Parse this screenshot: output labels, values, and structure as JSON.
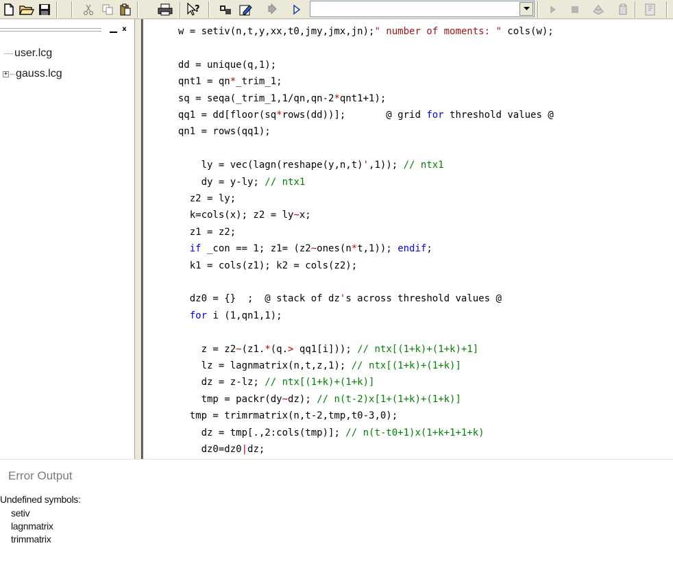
{
  "toolbar": {
    "buttons": [
      "new-file-icon",
      "open-folder-icon",
      "save-icon",
      "cut-icon",
      "copy-icon",
      "paste-icon",
      "print-icon",
      "context-help-icon",
      "compile-icon",
      "edit-icon",
      "step-icon",
      "run-icon",
      "go-icon",
      "stop-icon",
      "debug-icon",
      "clear-icon",
      "bookmark-icon"
    ],
    "combo_value": ""
  },
  "file_tree": {
    "items": [
      {
        "label": "user.lcg",
        "expandable": false
      },
      {
        "label": "gauss.lcg",
        "expandable": true
      }
    ],
    "minimize_glyph": "_",
    "close_glyph": "x"
  },
  "code": {
    "lines": [
      {
        "indent": "  ",
        "parts": [
          {
            "t": "w = setiv(n,t,y,xx,t0,jmy,jmx,jn);",
            "c": ""
          },
          {
            "t": "\" number of moments: \"",
            "c": "str"
          },
          {
            "t": " cols(w);",
            "c": ""
          }
        ]
      },
      {
        "indent": "",
        "parts": []
      },
      {
        "indent": "  ",
        "parts": [
          {
            "t": "dd = unique(q,1);",
            "c": ""
          }
        ]
      },
      {
        "indent": "  ",
        "parts": [
          {
            "t": "qnt1 = qn",
            "c": ""
          },
          {
            "t": "*",
            "c": "op"
          },
          {
            "t": "_trim_1;",
            "c": ""
          }
        ]
      },
      {
        "indent": "  ",
        "parts": [
          {
            "t": "sq = seqa(_trim_1,1/qn,qn-2",
            "c": ""
          },
          {
            "t": "*",
            "c": "op"
          },
          {
            "t": "qnt1+1);",
            "c": ""
          }
        ]
      },
      {
        "indent": "  ",
        "parts": [
          {
            "t": "qq1 = dd[floor(sq",
            "c": ""
          },
          {
            "t": "*",
            "c": "op"
          },
          {
            "t": "rows(dd))];       @ grid ",
            "c": ""
          },
          {
            "t": "for",
            "c": "kw"
          },
          {
            "t": " threshold values @",
            "c": ""
          }
        ]
      },
      {
        "indent": "  ",
        "parts": [
          {
            "t": "qn1 = rows(qq1);",
            "c": ""
          }
        ]
      },
      {
        "indent": "",
        "parts": []
      },
      {
        "indent": "      ",
        "parts": [
          {
            "t": "ly = vec(lagn(reshape(y,n,t)",
            "c": ""
          },
          {
            "t": "'",
            "c": "op"
          },
          {
            "t": ",1)); ",
            "c": ""
          },
          {
            "t": "// ntx1",
            "c": "cm"
          }
        ]
      },
      {
        "indent": "      ",
        "parts": [
          {
            "t": "dy = y-ly; ",
            "c": ""
          },
          {
            "t": "// ntx1",
            "c": "cm"
          }
        ]
      },
      {
        "indent": "    ",
        "parts": [
          {
            "t": "z2 = ly;",
            "c": ""
          }
        ]
      },
      {
        "indent": "    ",
        "parts": [
          {
            "t": "k=cols(x); z2 = ly",
            "c": ""
          },
          {
            "t": "~",
            "c": "op"
          },
          {
            "t": "x;",
            "c": ""
          }
        ]
      },
      {
        "indent": "    ",
        "parts": [
          {
            "t": "z1 = z2;",
            "c": ""
          }
        ]
      },
      {
        "indent": "    ",
        "parts": [
          {
            "t": "if",
            "c": "kw"
          },
          {
            "t": " _con == 1; z1= (z2",
            "c": ""
          },
          {
            "t": "~",
            "c": "op"
          },
          {
            "t": "ones(n",
            "c": ""
          },
          {
            "t": "*",
            "c": "op"
          },
          {
            "t": "t,1)); ",
            "c": ""
          },
          {
            "t": "endif",
            "c": "kw"
          },
          {
            "t": ";",
            "c": ""
          }
        ]
      },
      {
        "indent": "    ",
        "parts": [
          {
            "t": "k1 = cols(z1); k2 = cols(z2);",
            "c": ""
          }
        ]
      },
      {
        "indent": "",
        "parts": []
      },
      {
        "indent": "    ",
        "parts": [
          {
            "t": "dz0 = {}  ;  @ stack of dz",
            "c": ""
          },
          {
            "t": "'",
            "c": "op"
          },
          {
            "t": "s across threshold values @",
            "c": ""
          }
        ]
      },
      {
        "indent": "    ",
        "parts": [
          {
            "t": "for",
            "c": "kw"
          },
          {
            "t": " i (1,qn1,1);",
            "c": ""
          }
        ]
      },
      {
        "indent": "",
        "parts": []
      },
      {
        "indent": "      ",
        "parts": [
          {
            "t": "z = z2",
            "c": ""
          },
          {
            "t": "~",
            "c": "op"
          },
          {
            "t": "(z1.",
            "c": ""
          },
          {
            "t": "*",
            "c": "op"
          },
          {
            "t": "(q.",
            "c": ""
          },
          {
            "t": ">",
            "c": "op"
          },
          {
            "t": " qq1[i])); ",
            "c": ""
          },
          {
            "t": "// ntx[(1+k)+(1+k)+1]",
            "c": "cm"
          }
        ]
      },
      {
        "indent": "      ",
        "parts": [
          {
            "t": "lz = lagnmatrix(n,t,z,1); ",
            "c": ""
          },
          {
            "t": "// ntx[(1+k)+(1+k)]",
            "c": "cm"
          }
        ]
      },
      {
        "indent": "      ",
        "parts": [
          {
            "t": "dz = z-lz; ",
            "c": ""
          },
          {
            "t": "// ntx[(1+k)+(1+k)]",
            "c": "cm"
          }
        ]
      },
      {
        "indent": "      ",
        "parts": [
          {
            "t": "tmp = packr(dy",
            "c": ""
          },
          {
            "t": "~",
            "c": "op"
          },
          {
            "t": "dz); ",
            "c": ""
          },
          {
            "t": "// n(t-2)x[1+(1+k)+(1+k)]",
            "c": "cm"
          }
        ]
      },
      {
        "indent": "    ",
        "parts": [
          {
            "t": "tmp = trimrmatrix(n,t-2,tmp,t0-3,0);",
            "c": ""
          }
        ]
      },
      {
        "indent": "      ",
        "parts": [
          {
            "t": "dz = tmp[.,2:cols(tmp)]; ",
            "c": ""
          },
          {
            "t": "// n(t-t0+1)x(1+k+1+1+k)",
            "c": "cm"
          }
        ]
      },
      {
        "indent": "      ",
        "parts": [
          {
            "t": "dz0=dz0",
            "c": ""
          },
          {
            "t": "|",
            "c": "op"
          },
          {
            "t": "dz;",
            "c": ""
          }
        ]
      }
    ]
  },
  "error_output": {
    "title": "Error Output",
    "heading": "Undefined symbols:",
    "symbols": [
      "setiv",
      "lagnmatrix",
      "trimmatrix"
    ]
  }
}
